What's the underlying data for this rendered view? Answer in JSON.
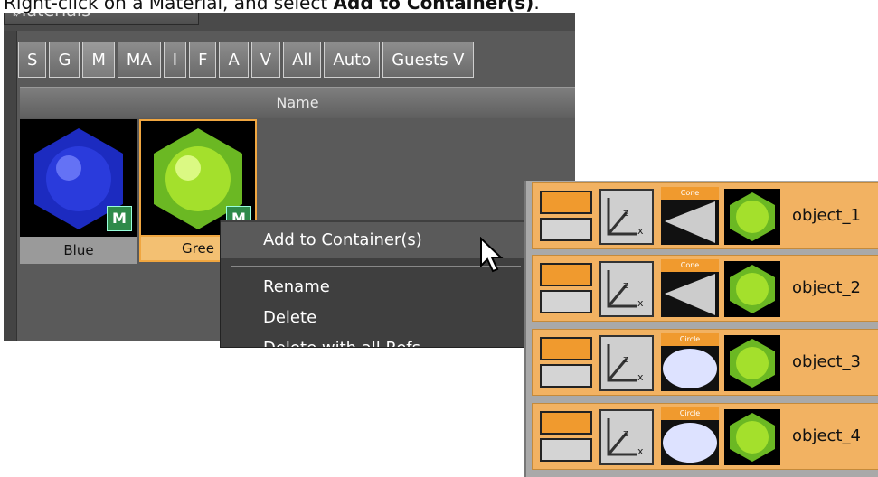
{
  "instruction": {
    "prefix": "Right-click on a Material, and select ",
    "bold": "Add to Container(s)",
    "suffix": "."
  },
  "panel": {
    "dropdown_label": "Materials",
    "tabs": [
      "S",
      "G",
      "M",
      "MA",
      "I",
      "F",
      "A",
      "V",
      "All",
      "Auto",
      "Guests V"
    ],
    "active_tab": "M",
    "column_header": "Name",
    "materials": [
      {
        "name": "Blue",
        "badge": "M",
        "color": "#2a3bdc"
      },
      {
        "name": "Gree",
        "badge": "M",
        "color": "#74c92a"
      }
    ]
  },
  "context_menu": {
    "items": [
      "Add to Container(s)",
      "Rename",
      "Delete",
      "Delete with all Refs"
    ]
  },
  "objects": [
    {
      "geometry": "Cone",
      "name": "object_1"
    },
    {
      "geometry": "Cone",
      "name": "object_2"
    },
    {
      "geometry": "Circle",
      "name": "object_3"
    },
    {
      "geometry": "Circle",
      "name": "object_4"
    }
  ]
}
